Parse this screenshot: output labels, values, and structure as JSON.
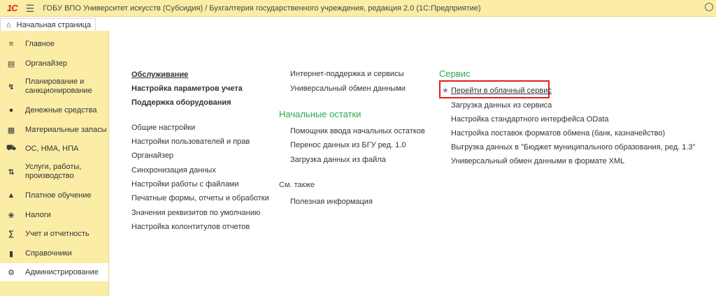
{
  "titlebar": {
    "logo": "1С",
    "title": "ГОБУ ВПО Университет искусств (Субсидия) / Бухгалтерия государственного учреждения, редакция 2.0  (1С:Предприятие)"
  },
  "tabs": {
    "home": "Начальная страница"
  },
  "sidebar": {
    "items": [
      {
        "label": "Главное",
        "icon": "list-icon"
      },
      {
        "label": "Органайзер",
        "icon": "organizer-icon"
      },
      {
        "label": "Планирование и санкционирование",
        "icon": "planning-icon"
      },
      {
        "label": "Денежные средства",
        "icon": "money-icon"
      },
      {
        "label": "Материальные запасы",
        "icon": "inventory-icon"
      },
      {
        "label": "ОС, НМА, НПА",
        "icon": "truck-icon"
      },
      {
        "label": "Услуги, работы, производство",
        "icon": "services-icon"
      },
      {
        "label": "Платное обучение",
        "icon": "graduation-cap-icon"
      },
      {
        "label": "Налоги",
        "icon": "emblem-icon"
      },
      {
        "label": "Учет и отчетность",
        "icon": "accounting-icon"
      },
      {
        "label": "Справочники",
        "icon": "book-icon"
      },
      {
        "label": "Администрирование",
        "icon": "gear-icon"
      }
    ]
  },
  "main": {
    "col1": {
      "links_bold": [
        "Обслуживание",
        "Настройка параметров учета",
        "Поддержка оборудования"
      ],
      "links": [
        "Общие настройки",
        "Настройки пользователей и прав",
        "Органайзер",
        "Синхронизация данных",
        "Настройки работы с файлами",
        "Печатные формы, отчеты и обработки",
        "Значения реквизитов по умолчанию",
        "Настройка колонтитулов отчетов"
      ]
    },
    "col2": {
      "top_links": [
        "Интернет-поддержка и сервисы",
        "Универсальный обмен данными"
      ],
      "section": "Начальные остатки",
      "section_links": [
        "Помощник ввода начальных остатков",
        "Перенос данных из БГУ ред. 1.0",
        "Загрузка данных из файла"
      ],
      "see_also": "См. также",
      "see_also_links": [
        "Полезная информация"
      ]
    },
    "col3": {
      "section": "Сервис",
      "links": [
        "Перейти в облачный сервис",
        "Загрузка данных из сервиса",
        "Настройка стандартного интерфейса OData",
        "Настройка поставок форматов обмена (банк, казначейство)",
        "Выгрузка данных в \"Бюджет муниципального образования, ред. 1.3\"",
        "Универсальный обмен данными в формате XML"
      ]
    }
  }
}
